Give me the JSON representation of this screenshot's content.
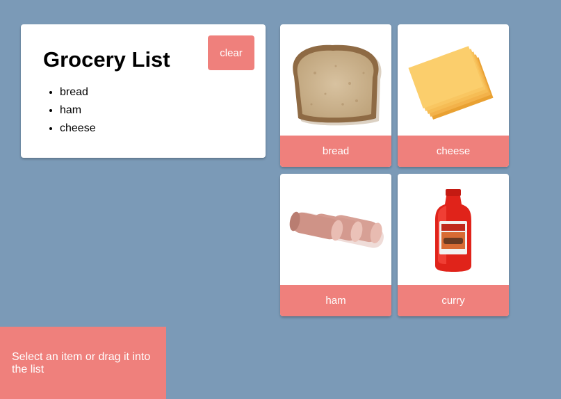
{
  "list": {
    "title": "Grocery List",
    "clear_label": "clear",
    "items": [
      "bread",
      "ham",
      "cheese"
    ]
  },
  "tiles": [
    {
      "label": "bread",
      "icon": "bread-slice-icon"
    },
    {
      "label": "cheese",
      "icon": "cheese-slices-icon"
    },
    {
      "label": "ham",
      "icon": "ham-rolls-icon"
    },
    {
      "label": "curry",
      "icon": "curry-bottle-icon"
    }
  ],
  "hint": "Select an item or drag it into the list",
  "colors": {
    "background": "#7b9ab7",
    "accent": "#ef807c",
    "card": "#ffffff"
  }
}
